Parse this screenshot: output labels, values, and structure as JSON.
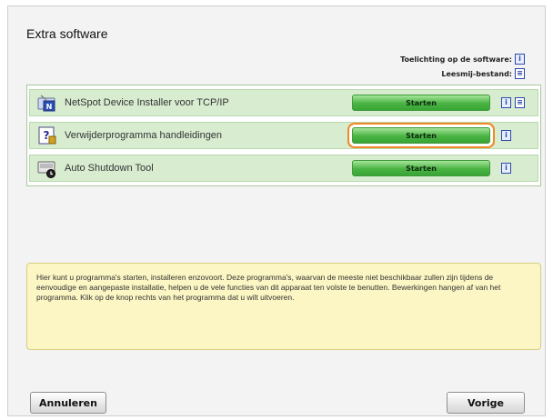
{
  "title": "Extra software",
  "help": {
    "explanation_label": "Toelichting op de software:",
    "readme_label": "Leesmij-bestand:"
  },
  "rows": [
    {
      "label": "NetSpot Device Installer voor TCP/IP",
      "button": "Starten",
      "icon": "network-installer-icon",
      "highlighted": false
    },
    {
      "label": "Verwijderprogramma handleidingen",
      "button": "Starten",
      "icon": "uninstall-manual-icon",
      "highlighted": true
    },
    {
      "label": "Auto Shutdown Tool",
      "button": "Starten",
      "icon": "auto-shutdown-icon",
      "highlighted": false
    }
  ],
  "description": "Hier kunt u programma's starten, installeren enzovoort. Deze programma's, waarvan de meeste niet beschikbaar zullen zijn tijdens de eenvoudige en aangepaste installatie, helpen u de vele functies van dit apparaat ten volste te benutten. Bewerkingen hangen af van het programma. Klik op de knop rechts van het programma dat u wilt uitvoeren.",
  "footer": {
    "cancel_label": "Annuleren",
    "back_label": "Vorige"
  },
  "colors": {
    "highlight": "#f18a24",
    "row_bg": "#d8ecd0",
    "button_green": "#49b343",
    "desc_bg": "#fbf6c3"
  }
}
